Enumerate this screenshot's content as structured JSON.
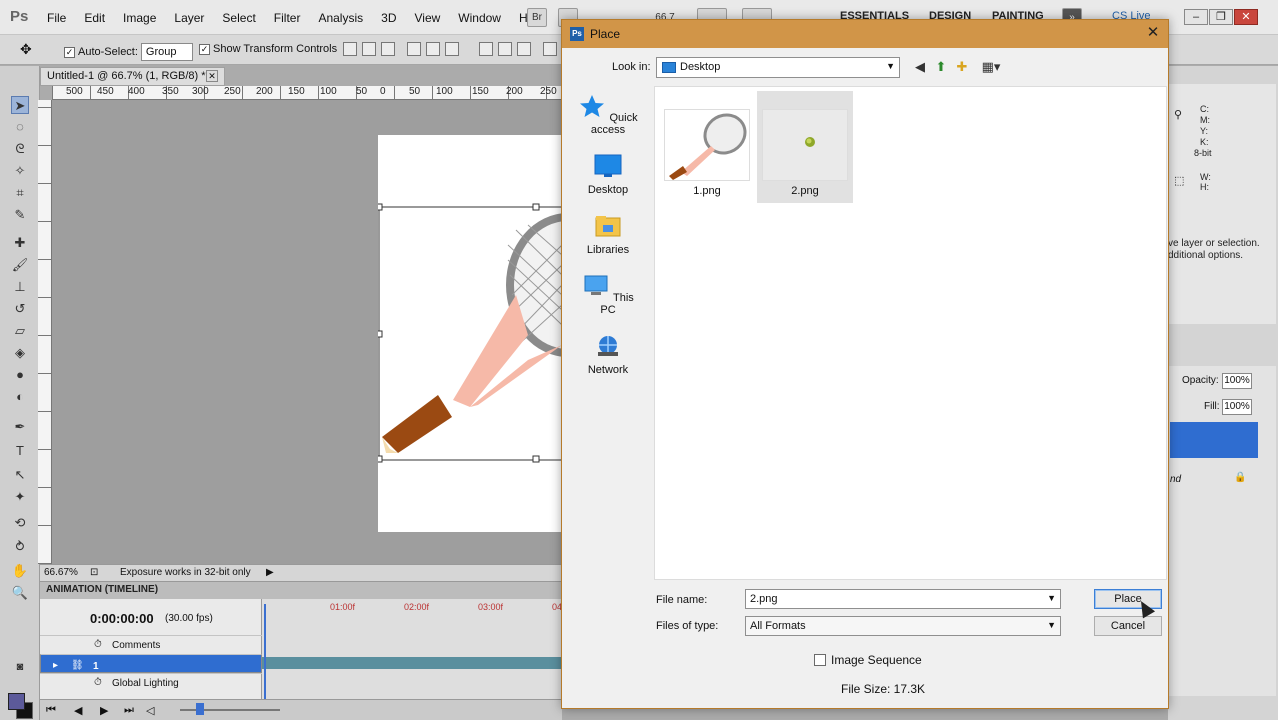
{
  "app": {
    "logo": "Ps",
    "menu": [
      "File",
      "Edit",
      "Image",
      "Layer",
      "Select",
      "Filter",
      "Analysis",
      "3D",
      "View",
      "Window",
      "Help"
    ],
    "bridge_label": "Br",
    "zoom_select": "66.7",
    "workspaces": [
      "ESSENTIALS",
      "DESIGN",
      "PAINTING"
    ],
    "cslive_label": "CS Live"
  },
  "options_bar": {
    "auto_select_label": "Auto-Select:",
    "auto_select_value": "Group",
    "show_transform_label": "Show Transform Controls"
  },
  "document": {
    "tab_title": "Untitled-1 @ 66.7% (1, RGB/8) *",
    "ruler_numbers": [
      "500",
      "450",
      "400",
      "350",
      "300",
      "250",
      "200",
      "150",
      "100",
      "50",
      "0",
      "50",
      "100",
      "150",
      "200",
      "250"
    ],
    "status_zoom": "66.67%",
    "status_text": "Exposure works in 32-bit only"
  },
  "animation": {
    "title": "ANIMATION (TIMELINE)",
    "timecode": "0:00:00:00",
    "fps": "(30.00 fps)",
    "tick_labels": [
      "01:00f",
      "02:00f",
      "03:00f",
      "04"
    ],
    "rows": [
      {
        "label": "Comments"
      },
      {
        "label": "1"
      },
      {
        "label": "Global Lighting"
      }
    ]
  },
  "info_panel": {
    "labels": [
      "C:",
      "M:",
      "Y:",
      "K:",
      "8-bit",
      "W:",
      "H:"
    ],
    "hint_line1": "ve layer or selection.",
    "hint_line2": "dditional options."
  },
  "layers_panel": {
    "opacity_label": "Opacity:",
    "opacity_value": "100%",
    "fill_label": "Fill:",
    "fill_value": "100%",
    "layer_suffix": "nd"
  },
  "dialog": {
    "title": "Place",
    "look_in_label": "Look in:",
    "look_in_value": "Desktop",
    "places": [
      "Quick access",
      "Desktop",
      "Libraries",
      "This PC",
      "Network"
    ],
    "files": [
      {
        "name": "1.png",
        "selected": false
      },
      {
        "name": "2.png",
        "selected": true
      }
    ],
    "file_name_label": "File name:",
    "file_name_value": "2.png",
    "files_of_type_label": "Files of type:",
    "files_of_type_value": "All Formats",
    "place_button": "Place",
    "cancel_button": "Cancel",
    "image_sequence_label": "Image Sequence",
    "file_size": "File Size: 17.3K"
  },
  "colors": {
    "dialog_title_bar": "#d19548",
    "selection_blue": "#2f6dd0",
    "foreground_swatch": "#5c5a9a"
  }
}
